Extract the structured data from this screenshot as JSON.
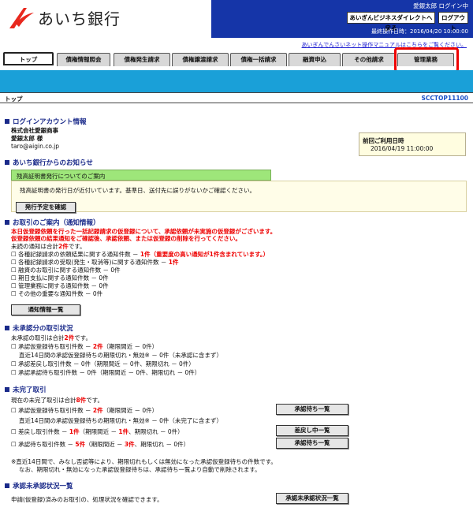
{
  "header": {
    "bank_name": "あいち銀行",
    "user_name": "愛銀太郎 ログイン中",
    "btn_business_direct": "あいぎんビジネスダイレクトへ戻る",
    "btn_logout": "ログアウト",
    "last_operation": "最終操作日時：2016/04/20 10:00:00",
    "manual_link": "あいぎんでんさいネット操作マニュアルはこちらをご覧ください。",
    "logo_color": "#e8281e"
  },
  "tabs": [
    "トップ",
    "債権情報照会",
    "債権発生請求",
    "債権譲渡請求",
    "債権一括請求",
    "融資申込",
    "その他請求",
    "管理業務"
  ],
  "breadcrumb": {
    "title": "トップ",
    "screen_id": "SCCTOP11100"
  },
  "login_info": {
    "title": "ログインアカウント情報",
    "company": "株式会社愛銀商事",
    "user": "愛銀太郎 様",
    "email": "taro@aigin.co.jp",
    "last_login_label": "前回ご利用日時",
    "last_login_value": "2016/04/19 11:00:00"
  },
  "notice": {
    "title": "あいち銀行からのお知らせ",
    "head": "残高証明書発行についてのご案内",
    "body": "残高証明書の発行日が近付いています。基準日、送付先に誤りがないかご確認ください。",
    "button": "発行予定を確認"
  },
  "transactions": {
    "title": "お取引のご案内（通知情報）",
    "alert1": "本日仮登録依頼を行った一括記録請求の仮登録について、承認依頼が未実施の仮登録がございます。",
    "alert2": "仮登録依頼の結果通知をご確認後、承認依頼、または仮登録の削除を行ってください。",
    "unread_prefix": "未読の通知は合計",
    "unread_count": "2件",
    "unread_suffix": "です。",
    "items": [
      {
        "label": "各種記録請求の依頼結果に関する通知件数 － ",
        "count": "1件",
        "note": "（重要度の高い通知が1件含まれています。）",
        "red": true
      },
      {
        "label": "各種記録請求の受取(発生・取消等)に関する通知件数 － ",
        "count": "1件",
        "note": "",
        "red": true
      },
      {
        "label": "融資のお取引に関する通知件数 － 0件",
        "count": "",
        "note": "",
        "red": false
      },
      {
        "label": "期日支払に関する通知件数 － 0件",
        "count": "",
        "note": "",
        "red": false
      },
      {
        "label": "管理業務に関する通知件数 － 0件",
        "count": "",
        "note": "",
        "red": false
      },
      {
        "label": "その他の重要な通知件数 － 0件",
        "count": "",
        "note": "",
        "red": false
      }
    ],
    "button": "通知情報一覧"
  },
  "unapproved": {
    "title": "未承認分の取引状況",
    "total_prefix": "未承認の取引は合計",
    "total_count": "2件",
    "total_suffix": "です。",
    "row1_a": "承認仮登録待ち取引件数 － ",
    "row1_b": "2件",
    "row1_c": "（期限間近 － 0件）",
    "row1_sub": "直近14日間の承認仮登録待ちの期限切れ・無効※ － 0件（未承認に含まず）",
    "row2": "承認差戻し取引件数 － 0件（期限間近 － 0件、期限切れ － 0件）",
    "row3": "承認承認待ち取引件数 － 0件（期限間近 － 0件、期限切れ － 0件）"
  },
  "incomplete": {
    "title": "未完了取引",
    "total_prefix": "現在の未完了取引は合計",
    "total_count": "8件",
    "total_suffix": "です。",
    "row1_a": "承認仮登録待ち取引件数 － ",
    "row1_b": "2件",
    "row1_c": "（期限間近 － 0件）",
    "row1_btn": "承認待ち一覧",
    "row1_sub": "直近14日間の承認仮登録待ちの期限切れ・無効※ － 0件（未完了に含まず）",
    "row2_a": "差戻し取引件数 － ",
    "row2_b": "1件",
    "row2_c": "（期限間近 － ",
    "row2_d": "1件",
    "row2_e": "、期限切れ － 0件）",
    "row2_btn": "差戻し中一覧",
    "row3_a": "承認待ち取引件数 － ",
    "row3_b": "5件",
    "row3_c": "（期限間近 － ",
    "row3_d": "3件",
    "row3_e": "、期限切れ － 0件）",
    "row3_btn": "承認待ち一覧",
    "footnote1": "※直近14日間で、みなし否認等により、期限切れもしくは無効になった承認仮登録待ちの件数です。",
    "footnote2": "なお、期限切れ・無効になった承認仮登録待ちは、承認待ち一覧より自動で削除されます。"
  },
  "approval_status": {
    "title": "承認未承認状況一覧",
    "desc": "申請(仮登録)済みのお取引の、処理状況を確認できます。",
    "button": "承認未承認状況一覧"
  }
}
